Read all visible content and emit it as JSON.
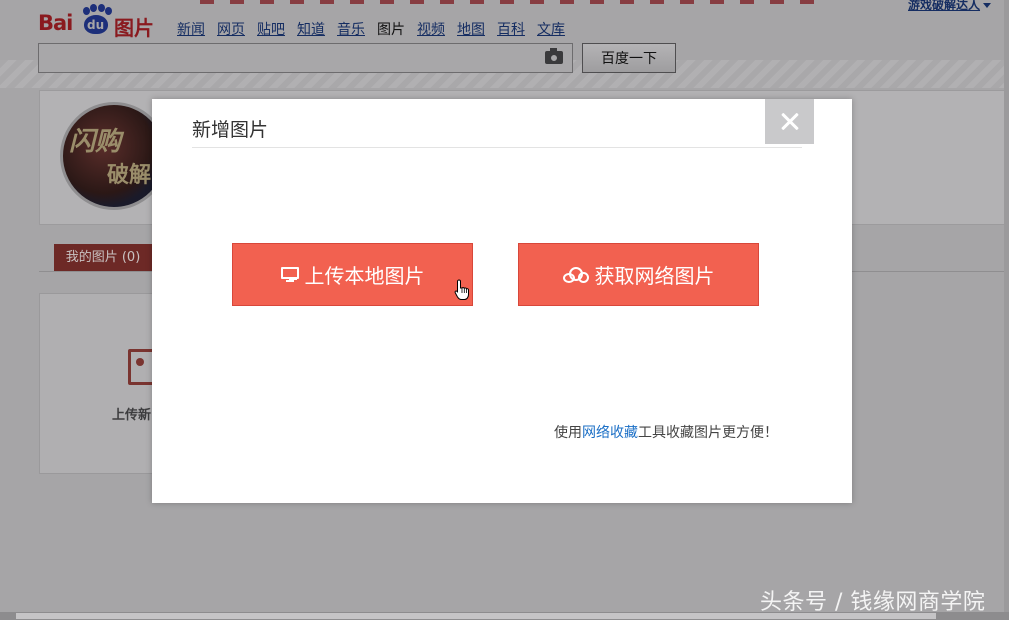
{
  "header": {
    "logo": {
      "bai": "Bai",
      "du": "du",
      "tupian": "图片"
    },
    "nav": [
      {
        "label": "新闻",
        "current": false
      },
      {
        "label": "网页",
        "current": false
      },
      {
        "label": "贴吧",
        "current": false
      },
      {
        "label": "知道",
        "current": false
      },
      {
        "label": "音乐",
        "current": false
      },
      {
        "label": "图片",
        "current": true
      },
      {
        "label": "视频",
        "current": false
      },
      {
        "label": "地图",
        "current": false
      },
      {
        "label": "百科",
        "current": false
      },
      {
        "label": "文库",
        "current": false
      }
    ],
    "user_link": "游戏破解达人",
    "search": {
      "value": "",
      "placeholder": "",
      "button_label": "百度一下"
    }
  },
  "background": {
    "tab_label": "我的图片 (0)",
    "upload_label": "上传新"
  },
  "modal": {
    "title": "新增图片",
    "upload_local_label": "上传本地图片",
    "fetch_web_label": "获取网络图片",
    "footer": {
      "prefix": "使用",
      "link": "网络收藏",
      "suffix": "工具收藏图片更方便！"
    }
  },
  "watermark": "头条号 / 钱缘网商学院",
  "colors": {
    "accent": "#f26150",
    "link": "#1b6fc6",
    "tab_active": "#6d2926"
  }
}
